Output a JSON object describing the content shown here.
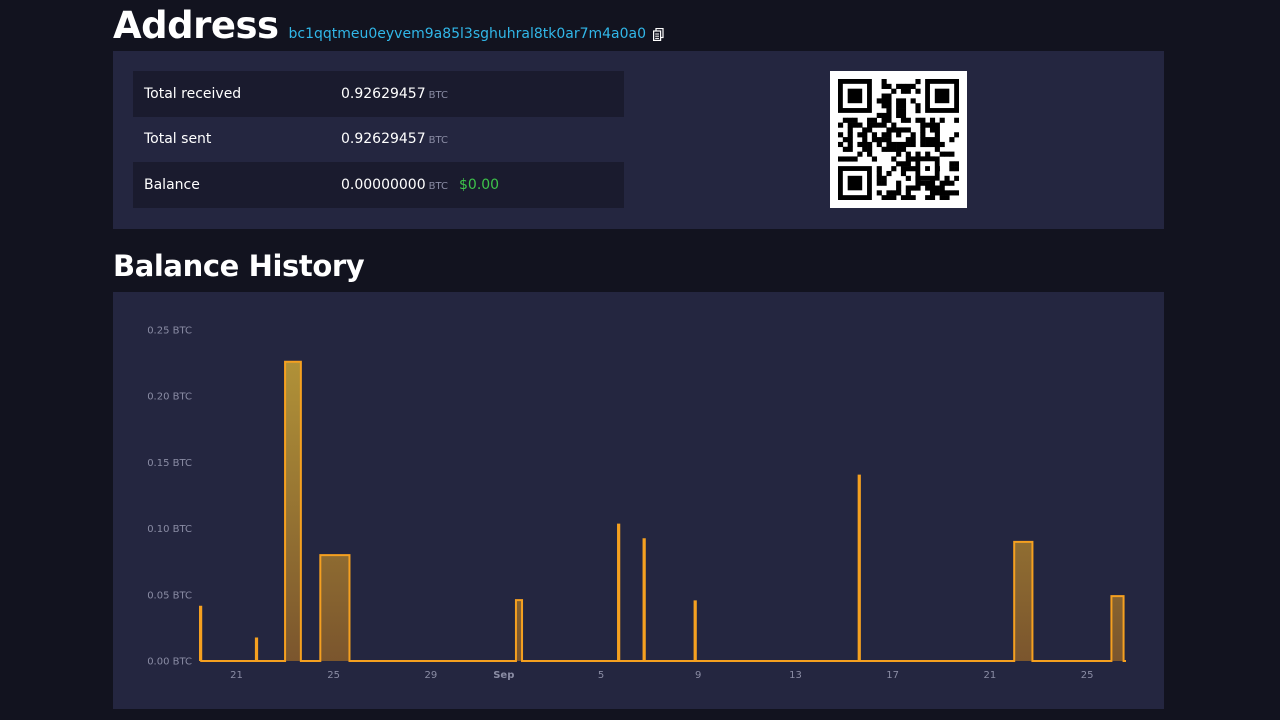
{
  "header": {
    "title": "Address",
    "address": "bc1qqtmeu0eyvem9a85l3sghuhral8tk0ar7m4a0a0",
    "copy_icon": "copy-icon"
  },
  "summary": {
    "rows": [
      {
        "label": "Total received",
        "value": "0.92629457",
        "unit": "BTC",
        "fiat": ""
      },
      {
        "label": "Total sent",
        "value": "0.92629457",
        "unit": "BTC",
        "fiat": ""
      },
      {
        "label": "Balance",
        "value": "0.00000000",
        "unit": "BTC",
        "fiat": "$0.00"
      }
    ],
    "fiat_color": "#3dc34a",
    "qr_icon": "qr-code-icon"
  },
  "history": {
    "title": "Balance History"
  },
  "colors": {
    "background": "#12131f",
    "card": "#242640",
    "accent_link": "#31b7e8",
    "bar_stroke": "#f5a020",
    "bar_fill": "#9b6a2a"
  },
  "chart_data": {
    "type": "area",
    "yticks": [
      "0.00 BTC",
      "0.05 BTC",
      "0.10 BTC",
      "0.15 BTC",
      "0.20 BTC",
      "0.25 BTC"
    ],
    "ylim": [
      0,
      0.25
    ],
    "xticks": [
      {
        "label": "21",
        "day": 0
      },
      {
        "label": "25",
        "day": 4
      },
      {
        "label": "29",
        "day": 8
      },
      {
        "label": "Sep",
        "day": 11,
        "bold": true
      },
      {
        "label": "5",
        "day": 15
      },
      {
        "label": "9",
        "day": 19
      },
      {
        "label": "13",
        "day": 23
      },
      {
        "label": "17",
        "day": 27
      },
      {
        "label": "21",
        "day": 31
      },
      {
        "label": "25",
        "day": 35
      }
    ],
    "xlim": [
      -1.5,
      36.6
    ],
    "series": [
      {
        "points": [
          {
            "x0": -1.5,
            "x1": -1.45,
            "y": 0.041
          },
          {
            "x0": 0.8,
            "x1": 0.85,
            "y": 0.017
          },
          {
            "x0": 2.0,
            "x1": 2.65,
            "y": 0.226
          },
          {
            "x0": 3.45,
            "x1": 4.65,
            "y": 0.08
          },
          {
            "x0": 11.5,
            "x1": 11.75,
            "y": 0.046
          },
          {
            "x0": 15.7,
            "x1": 15.75,
            "y": 0.103
          },
          {
            "x0": 16.75,
            "x1": 16.8,
            "y": 0.092
          },
          {
            "x0": 18.85,
            "x1": 18.9,
            "y": 0.045
          },
          {
            "x0": 25.6,
            "x1": 25.65,
            "y": 0.14
          },
          {
            "x0": 32.0,
            "x1": 32.75,
            "y": 0.09
          },
          {
            "x0": 36.0,
            "x1": 36.5,
            "y": 0.049
          }
        ]
      }
    ]
  }
}
